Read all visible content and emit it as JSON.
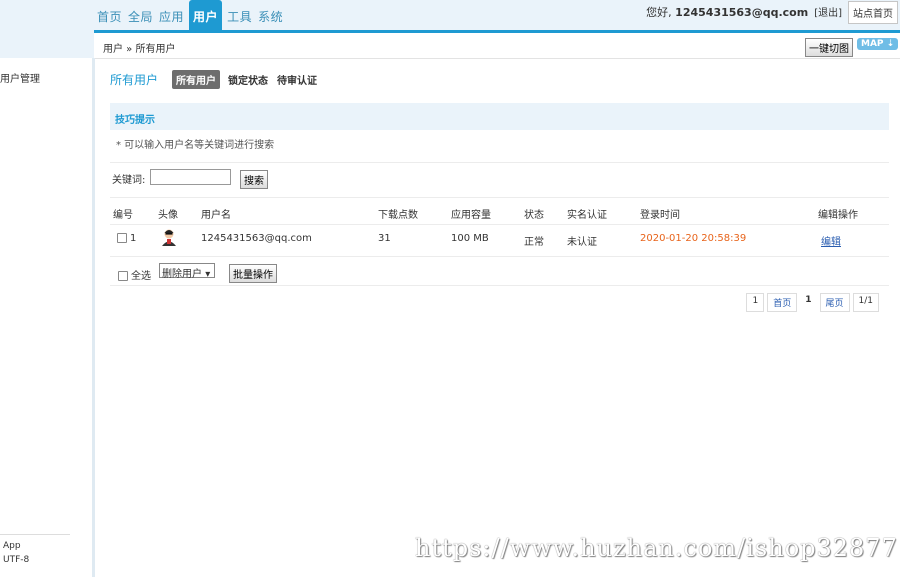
{
  "nav": {
    "items": [
      "首页",
      "全局",
      "应用",
      "用户",
      "工具",
      "系统"
    ],
    "active_index": 3
  },
  "topright": {
    "greeting": "您好,",
    "user": "1245431563@qq.com",
    "logout": "[退出]",
    "site_home": "站点首页"
  },
  "breadcrumb": "用户 » 所有用户",
  "toolbar": {
    "quick": "一键切图",
    "map": "MAP ⇣"
  },
  "sidebar": {
    "item": "用户管理",
    "app": "App",
    "encoding": "UTF-8"
  },
  "tabs": {
    "title": "所有用户",
    "items": [
      "所有用户",
      "锁定状态",
      "待审认证"
    ]
  },
  "tip": {
    "title": "技巧提示",
    "text": "* 可以输入用户名等关键词进行搜索"
  },
  "search": {
    "label": "关键词:",
    "value": "",
    "button": "搜索"
  },
  "table": {
    "headers": [
      "编号",
      "头像",
      "用户名",
      "下载点数",
      "应用容量",
      "状态",
      "实名认证",
      "登录时间",
      "编辑操作"
    ],
    "row": {
      "id": "1",
      "username": "1245431563@qq.com",
      "points": "31",
      "capacity": "100 MB",
      "status": "正常",
      "verified": "未认证",
      "login_time": "2020-01-20 20:58:39",
      "action": "编辑"
    }
  },
  "batch": {
    "select_all": "全选",
    "selected_option": "删除用户",
    "button": "批量操作"
  },
  "pager": {
    "first_num": "1",
    "first": "首页",
    "current": "1",
    "last": "尾页",
    "summary": "1/1"
  },
  "watermark": "https://www.huzhan.com/ishop32877",
  "colors": {
    "accent": "#1e9ad2",
    "link": "#2a5db0",
    "time": "#e8641b"
  }
}
